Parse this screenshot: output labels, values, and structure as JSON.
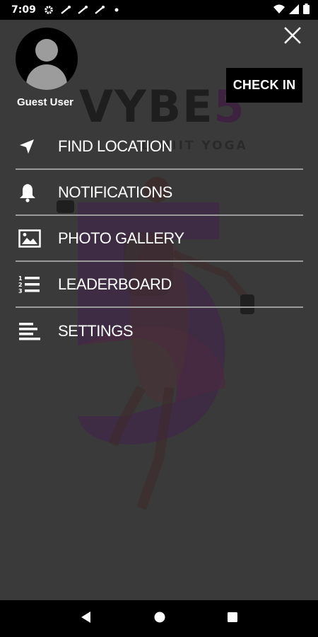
{
  "status_bar": {
    "time": "7:09",
    "left_icons": [
      "settings-gear-icon",
      "wrench-icon",
      "wrench-icon",
      "wrench-icon",
      "dot-icon"
    ],
    "right_icons": [
      "wifi-icon",
      "signal-icon",
      "battery-icon"
    ]
  },
  "background": {
    "logo_main": "VYBE",
    "logo_five": "5",
    "tagline": "D HIIT YOGA"
  },
  "drawer": {
    "user": {
      "name": "Guest User"
    },
    "check_in_label": "CHECK IN",
    "items": [
      {
        "label": "FIND LOCATION",
        "icon": "navigation-arrow-icon"
      },
      {
        "label": "NOTIFICATIONS",
        "icon": "bell-icon"
      },
      {
        "label": "PHOTO GALLERY",
        "icon": "image-icon"
      },
      {
        "label": "LEADERBOARD",
        "icon": "numbered-list-icon"
      },
      {
        "label": "SETTINGS",
        "icon": "settings-lines-icon"
      }
    ]
  },
  "nav_bar": {
    "buttons": [
      "back-icon",
      "home-icon",
      "recents-icon"
    ]
  },
  "colors": {
    "overlay": "#3a3a3a",
    "divider": "#9a9a9a",
    "button": "#000000"
  }
}
